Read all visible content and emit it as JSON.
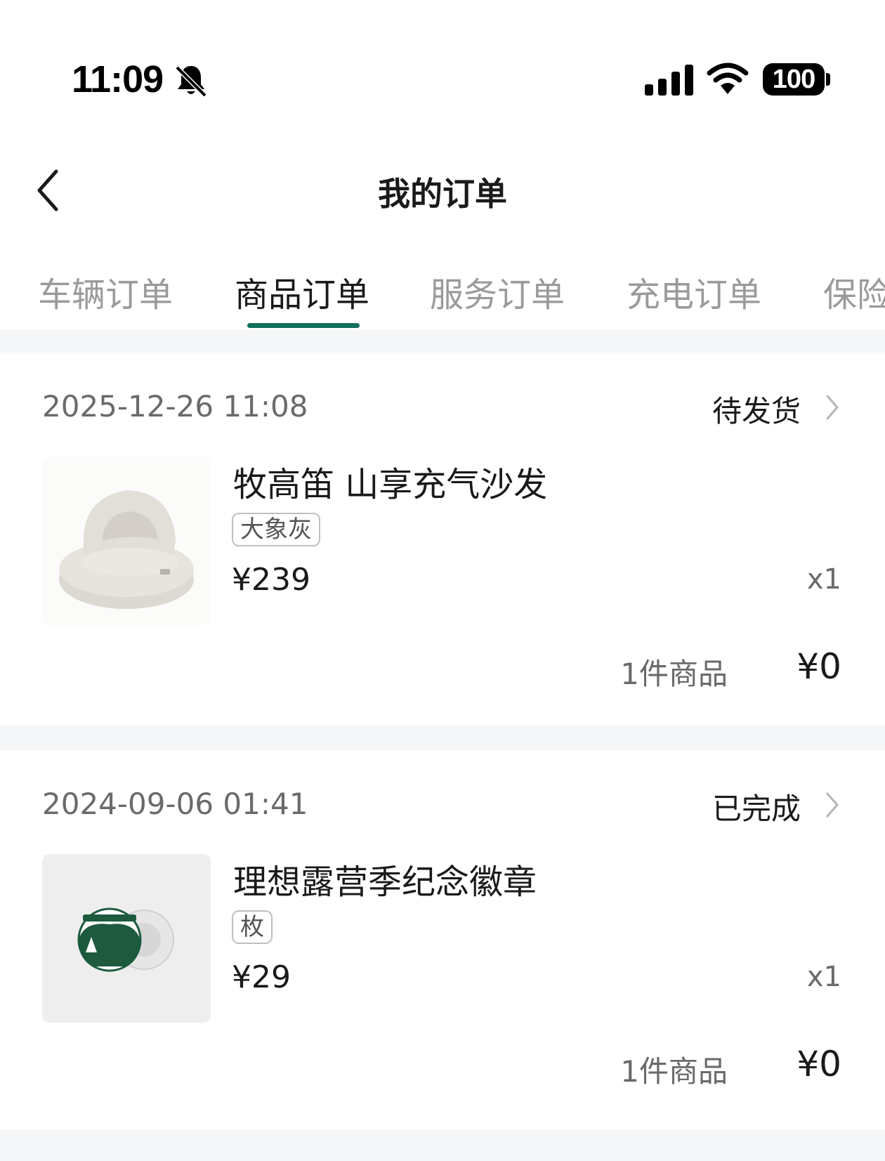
{
  "status_bar": {
    "time": "11:09",
    "battery": "100"
  },
  "header": {
    "title": "我的订单"
  },
  "tabs": [
    {
      "label": "车辆订单"
    },
    {
      "label": "商品订单"
    },
    {
      "label": "服务订单"
    },
    {
      "label": "充电订单"
    },
    {
      "label": "保险订单"
    }
  ],
  "orders": [
    {
      "date": "2025-12-26 11:08",
      "status": "待发货",
      "product": "牧高笛 山享充气沙发",
      "variant": "大象灰",
      "price": "¥239",
      "qty": "x1",
      "count": "1件商品",
      "total": "¥0"
    },
    {
      "date": "2024-09-06 01:41",
      "status": "已完成",
      "product": "理想露营季纪念徽章",
      "variant": "枚",
      "price": "¥29",
      "qty": "x1",
      "count": "1件商品",
      "total": "¥0"
    }
  ],
  "colors": {
    "accent": "#13705f",
    "gap": "#f5f6f7"
  }
}
